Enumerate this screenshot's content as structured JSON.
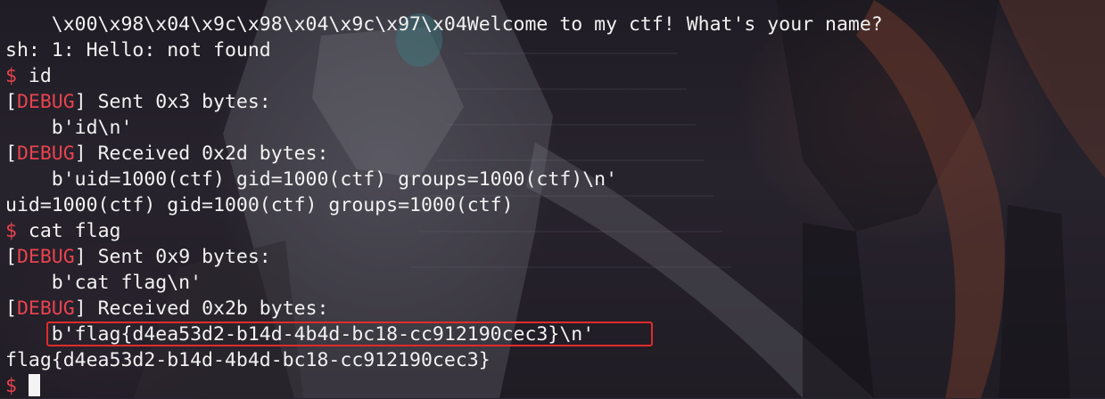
{
  "terminal": {
    "lines": [
      "    \\x00\\x98\\x04\\x9c\\x98\\x04\\x9c\\x97\\x04Welcome to my ctf! What's your name?",
      "sh: 1: Hello: not found"
    ],
    "prompt_symbol": "$",
    "command_1": "id",
    "debug_open": "[",
    "debug_label": "DEBUG",
    "debug_close": "]",
    "sent_1": " Sent 0x3 bytes:",
    "sent_1_bytes": "    b'id\\n'",
    "received_1": " Received 0x2d bytes:",
    "received_1_bytes": "    b'uid=1000(ctf) gid=1000(ctf) groups=1000(ctf)\\n'",
    "output_1": "uid=1000(ctf) gid=1000(ctf) groups=1000(ctf)",
    "command_2": "cat flag",
    "sent_2": " Sent 0x9 bytes:",
    "sent_2_bytes": "    b'cat flag\\n'",
    "received_2": " Received 0x2b bytes:",
    "received_2_bytes": "    b'flag{d4ea53d2-b14d-4b4d-bc18-cc912190cec3}\\n'",
    "output_2": "flag{d4ea53d2-b14d-4b4d-bc18-cc912190cec3}"
  },
  "colors": {
    "text": "#f2f2f2",
    "prompt": "#e8434e",
    "debug": "#e8434e",
    "highlight_border": "#e02b2b"
  }
}
